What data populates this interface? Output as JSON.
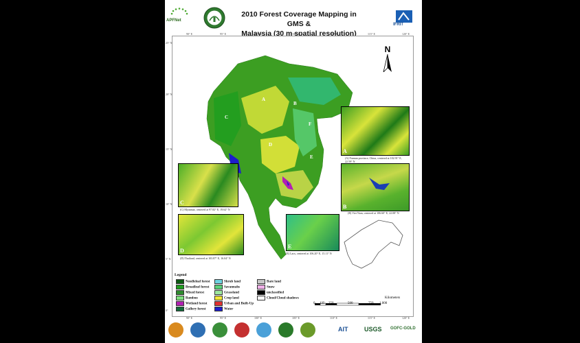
{
  "title_line1": "2010 Forest Coverage Mapping in GMS &",
  "title_line2": "Malaysia (30 m spatial resolution)",
  "logos": {
    "apfnet": "APFNet",
    "ifrit": "IFRIT",
    "ait": "AIT",
    "usgs": "USGS",
    "gofc": "GOFC-GOLD"
  },
  "north": "N",
  "lon_ticks": [
    "90° E",
    "95° E",
    "100° E",
    "105° E",
    "110° E",
    "115° E",
    "120° E"
  ],
  "lat_ticks": [
    "25° N",
    "20° N",
    "15° N",
    "10° N",
    "5° N",
    "0°"
  ],
  "region_labels": [
    "A",
    "B",
    "C",
    "D",
    "E",
    "F"
  ],
  "insets": [
    {
      "letter": "A",
      "caption": "(A) Yunnan province, China, centered at 102.91° E, 22.59° N",
      "colors": [
        "#3c9e22",
        "#d8e33a",
        "#1e7a18"
      ]
    },
    {
      "letter": "B",
      "caption": "(B) Viet Nam, centered at 106.60° E, 22.08° N",
      "colors": [
        "#59b22d",
        "#c6d84a",
        "#1a3fb3"
      ]
    },
    {
      "letter": "C",
      "caption": "(C) Myanmar, centered at 97.82° E, 19.62° N",
      "colors": [
        "#4cae28",
        "#d9e04a",
        "#2a8a20"
      ]
    },
    {
      "letter": "D",
      "caption": "(D) Thailand, centered at 103.87° E, 16.04° N",
      "colors": [
        "#e2e53a",
        "#7cc832",
        "#2a8a20"
      ]
    },
    {
      "letter": "E",
      "caption": "(E) Laos, centered at 106.20° E, 15.11° N",
      "colors": [
        "#2fbf88",
        "#6ad04a",
        "#188a5a"
      ]
    }
  ],
  "legend": {
    "title": "Legend",
    "items": [
      {
        "label": "Needleleaf forest",
        "color": "#0b5a12"
      },
      {
        "label": "Broadleaf forest",
        "color": "#1f9e1f"
      },
      {
        "label": "Mixed forest",
        "color": "#2e8b2e"
      },
      {
        "label": "Bamboo",
        "color": "#7ee07e"
      },
      {
        "label": "Wetland forest",
        "color": "#b31fb3"
      },
      {
        "label": "Gallery forest",
        "color": "#126b3a"
      },
      {
        "label": "Shrub land",
        "color": "#6fd3e0"
      },
      {
        "label": "Savannahs",
        "color": "#5bd17a"
      },
      {
        "label": "Grassland",
        "color": "#9ee89e"
      },
      {
        "label": "Crop land",
        "color": "#f2e63a"
      },
      {
        "label": "Urban and Built-Up",
        "color": "#e03030"
      },
      {
        "label": "Water",
        "color": "#1d1dcc"
      },
      {
        "label": "Bare land",
        "color": "#c8c8c8"
      },
      {
        "label": "Snow",
        "color": "#f0b0e8"
      },
      {
        "label": "unclassified",
        "color": "#000000"
      },
      {
        "label": "Cloud/Cloud shadows",
        "color": "#ffffff"
      }
    ]
  },
  "scale": {
    "unit": "Kilometers",
    "labels": [
      "0",
      "125",
      "250",
      "500",
      "750",
      "1,000"
    ]
  }
}
